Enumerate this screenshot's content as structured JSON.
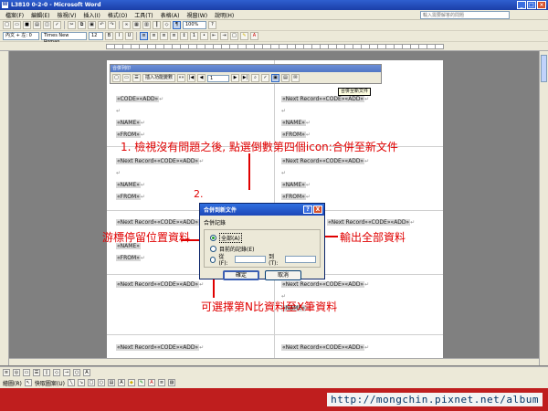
{
  "window": {
    "title": "L3810 0-2-0 - Microsoft Word",
    "help_placeholder": "輸入需要解答的問題"
  },
  "menu": [
    "檔案(F)",
    "編輯(E)",
    "檢視(V)",
    "插入(I)",
    "格式(O)",
    "工具(T)",
    "表格(A)",
    "視窗(W)",
    "說明(H)"
  ],
  "toolbar": {
    "zoom": "100%",
    "style": "內文 + 左: 0",
    "font": "Times New Roman",
    "size": "12"
  },
  "merge_toolbar": {
    "title": "合併列印",
    "insert_field": "插入功能變數",
    "record": "1",
    "tooltip": "合併至新文件"
  },
  "document": {
    "code_add": "«CODE»«ADD»",
    "name": "«NAME»",
    "from": "«FROM»",
    "next_code_add": "«Next Record»«CODE»«ADD»",
    "pmark": "↵"
  },
  "dialog": {
    "title": "合併到新文件",
    "group_label": "合併記錄",
    "opt_all": "全部(A)",
    "opt_current": "目前的記錄(E)",
    "opt_from": "從(F):",
    "opt_to": "到(T):",
    "ok": "確定",
    "cancel": "取消",
    "help": "?",
    "close": "X"
  },
  "annotations": {
    "step1": "1. 檢視沒有問題之後, 點選倒數第四個icon:合併至新文件",
    "step2": "2.",
    "cursor": "游標停留位置資料",
    "all": "輸出全部資料",
    "range": "可選擇第N比資料至X筆資料"
  },
  "draw_toolbar": {
    "draw": "繪圖(R)",
    "autoshapes": "快取圖案(U)"
  },
  "footer_url": "http://mongchin.pixnet.net/album",
  "colors": {
    "annotation": "#e00000",
    "footer": "#bf1e1e",
    "title_bar": "#1b3fa8"
  }
}
